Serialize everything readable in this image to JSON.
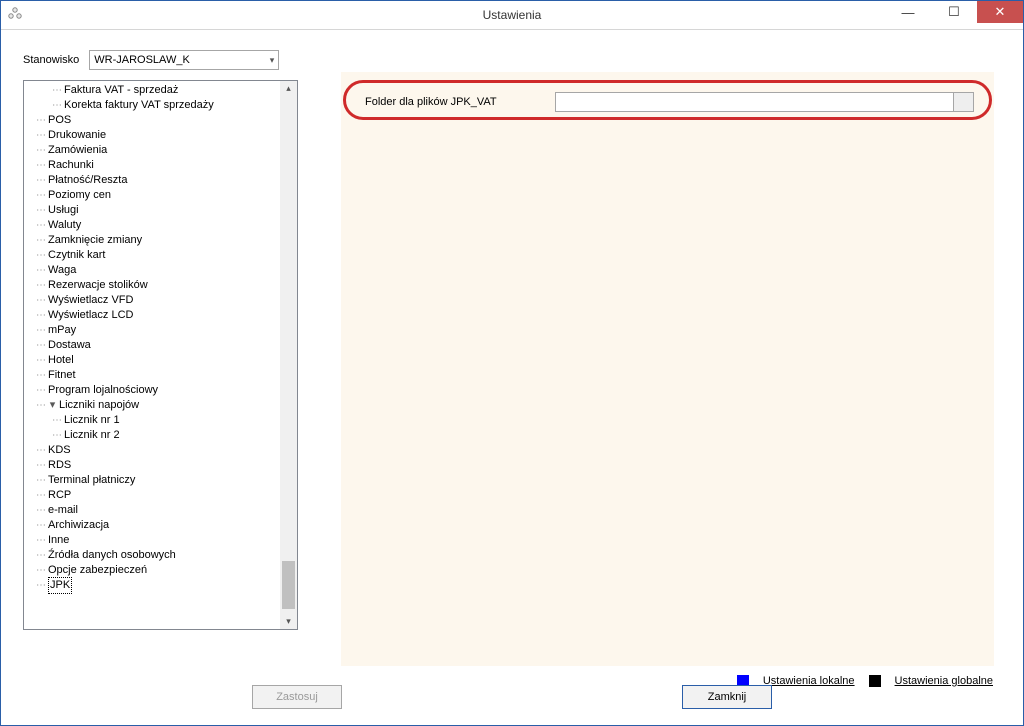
{
  "window": {
    "title": "Ustawienia"
  },
  "station": {
    "label": "Stanowisko",
    "value": "WR-JAROSLAW_K"
  },
  "tree": {
    "items": [
      {
        "label": "Faktura VAT - sprzedaż",
        "depth": 3,
        "expander": ""
      },
      {
        "label": "Korekta faktury VAT sprzedaży",
        "depth": 3,
        "expander": ""
      },
      {
        "label": "POS",
        "depth": 2,
        "expander": ""
      },
      {
        "label": "Drukowanie",
        "depth": 2,
        "expander": ""
      },
      {
        "label": "Zamówienia",
        "depth": 2,
        "expander": ""
      },
      {
        "label": "Rachunki",
        "depth": 2,
        "expander": ""
      },
      {
        "label": "Płatność/Reszta",
        "depth": 2,
        "expander": ""
      },
      {
        "label": "Poziomy cen",
        "depth": 2,
        "expander": ""
      },
      {
        "label": "Usługi",
        "depth": 2,
        "expander": ""
      },
      {
        "label": "Waluty",
        "depth": 2,
        "expander": ""
      },
      {
        "label": "Zamknięcie zmiany",
        "depth": 2,
        "expander": ""
      },
      {
        "label": "Czytnik kart",
        "depth": 2,
        "expander": ""
      },
      {
        "label": "Waga",
        "depth": 2,
        "expander": ""
      },
      {
        "label": "Rezerwacje stolików",
        "depth": 2,
        "expander": ""
      },
      {
        "label": "Wyświetlacz VFD",
        "depth": 2,
        "expander": ""
      },
      {
        "label": "Wyświetlacz LCD",
        "depth": 2,
        "expander": ""
      },
      {
        "label": "mPay",
        "depth": 2,
        "expander": ""
      },
      {
        "label": "Dostawa",
        "depth": 2,
        "expander": ""
      },
      {
        "label": "Hotel",
        "depth": 2,
        "expander": ""
      },
      {
        "label": "Fitnet",
        "depth": 2,
        "expander": ""
      },
      {
        "label": "Program lojalnościowy",
        "depth": 2,
        "expander": ""
      },
      {
        "label": "Liczniki napojów",
        "depth": 2,
        "expander": "▾"
      },
      {
        "label": "Licznik nr 1",
        "depth": 3,
        "expander": ""
      },
      {
        "label": "Licznik nr 2",
        "depth": 3,
        "expander": ""
      },
      {
        "label": "KDS",
        "depth": 2,
        "expander": ""
      },
      {
        "label": "RDS",
        "depth": 2,
        "expander": ""
      },
      {
        "label": "Terminal płatniczy",
        "depth": 2,
        "expander": ""
      },
      {
        "label": "RCP",
        "depth": 2,
        "expander": ""
      },
      {
        "label": "e-mail",
        "depth": 2,
        "expander": ""
      },
      {
        "label": "Archiwizacja",
        "depth": 2,
        "expander": ""
      },
      {
        "label": "Inne",
        "depth": 2,
        "expander": ""
      },
      {
        "label": "Źródła danych osobowych",
        "depth": 2,
        "expander": ""
      },
      {
        "label": "Opcje zabezpieczeń",
        "depth": 2,
        "expander": ""
      },
      {
        "label": "JPK",
        "depth": 2,
        "expander": "",
        "selected": true
      }
    ]
  },
  "form": {
    "folder_label": "Folder dla plików JPK_VAT",
    "folder_value": ""
  },
  "legend": {
    "local": "Ustawienia lokalne",
    "global": "Ustawienia globalne"
  },
  "buttons": {
    "apply": "Zastosuj",
    "close": "Zamknij"
  }
}
